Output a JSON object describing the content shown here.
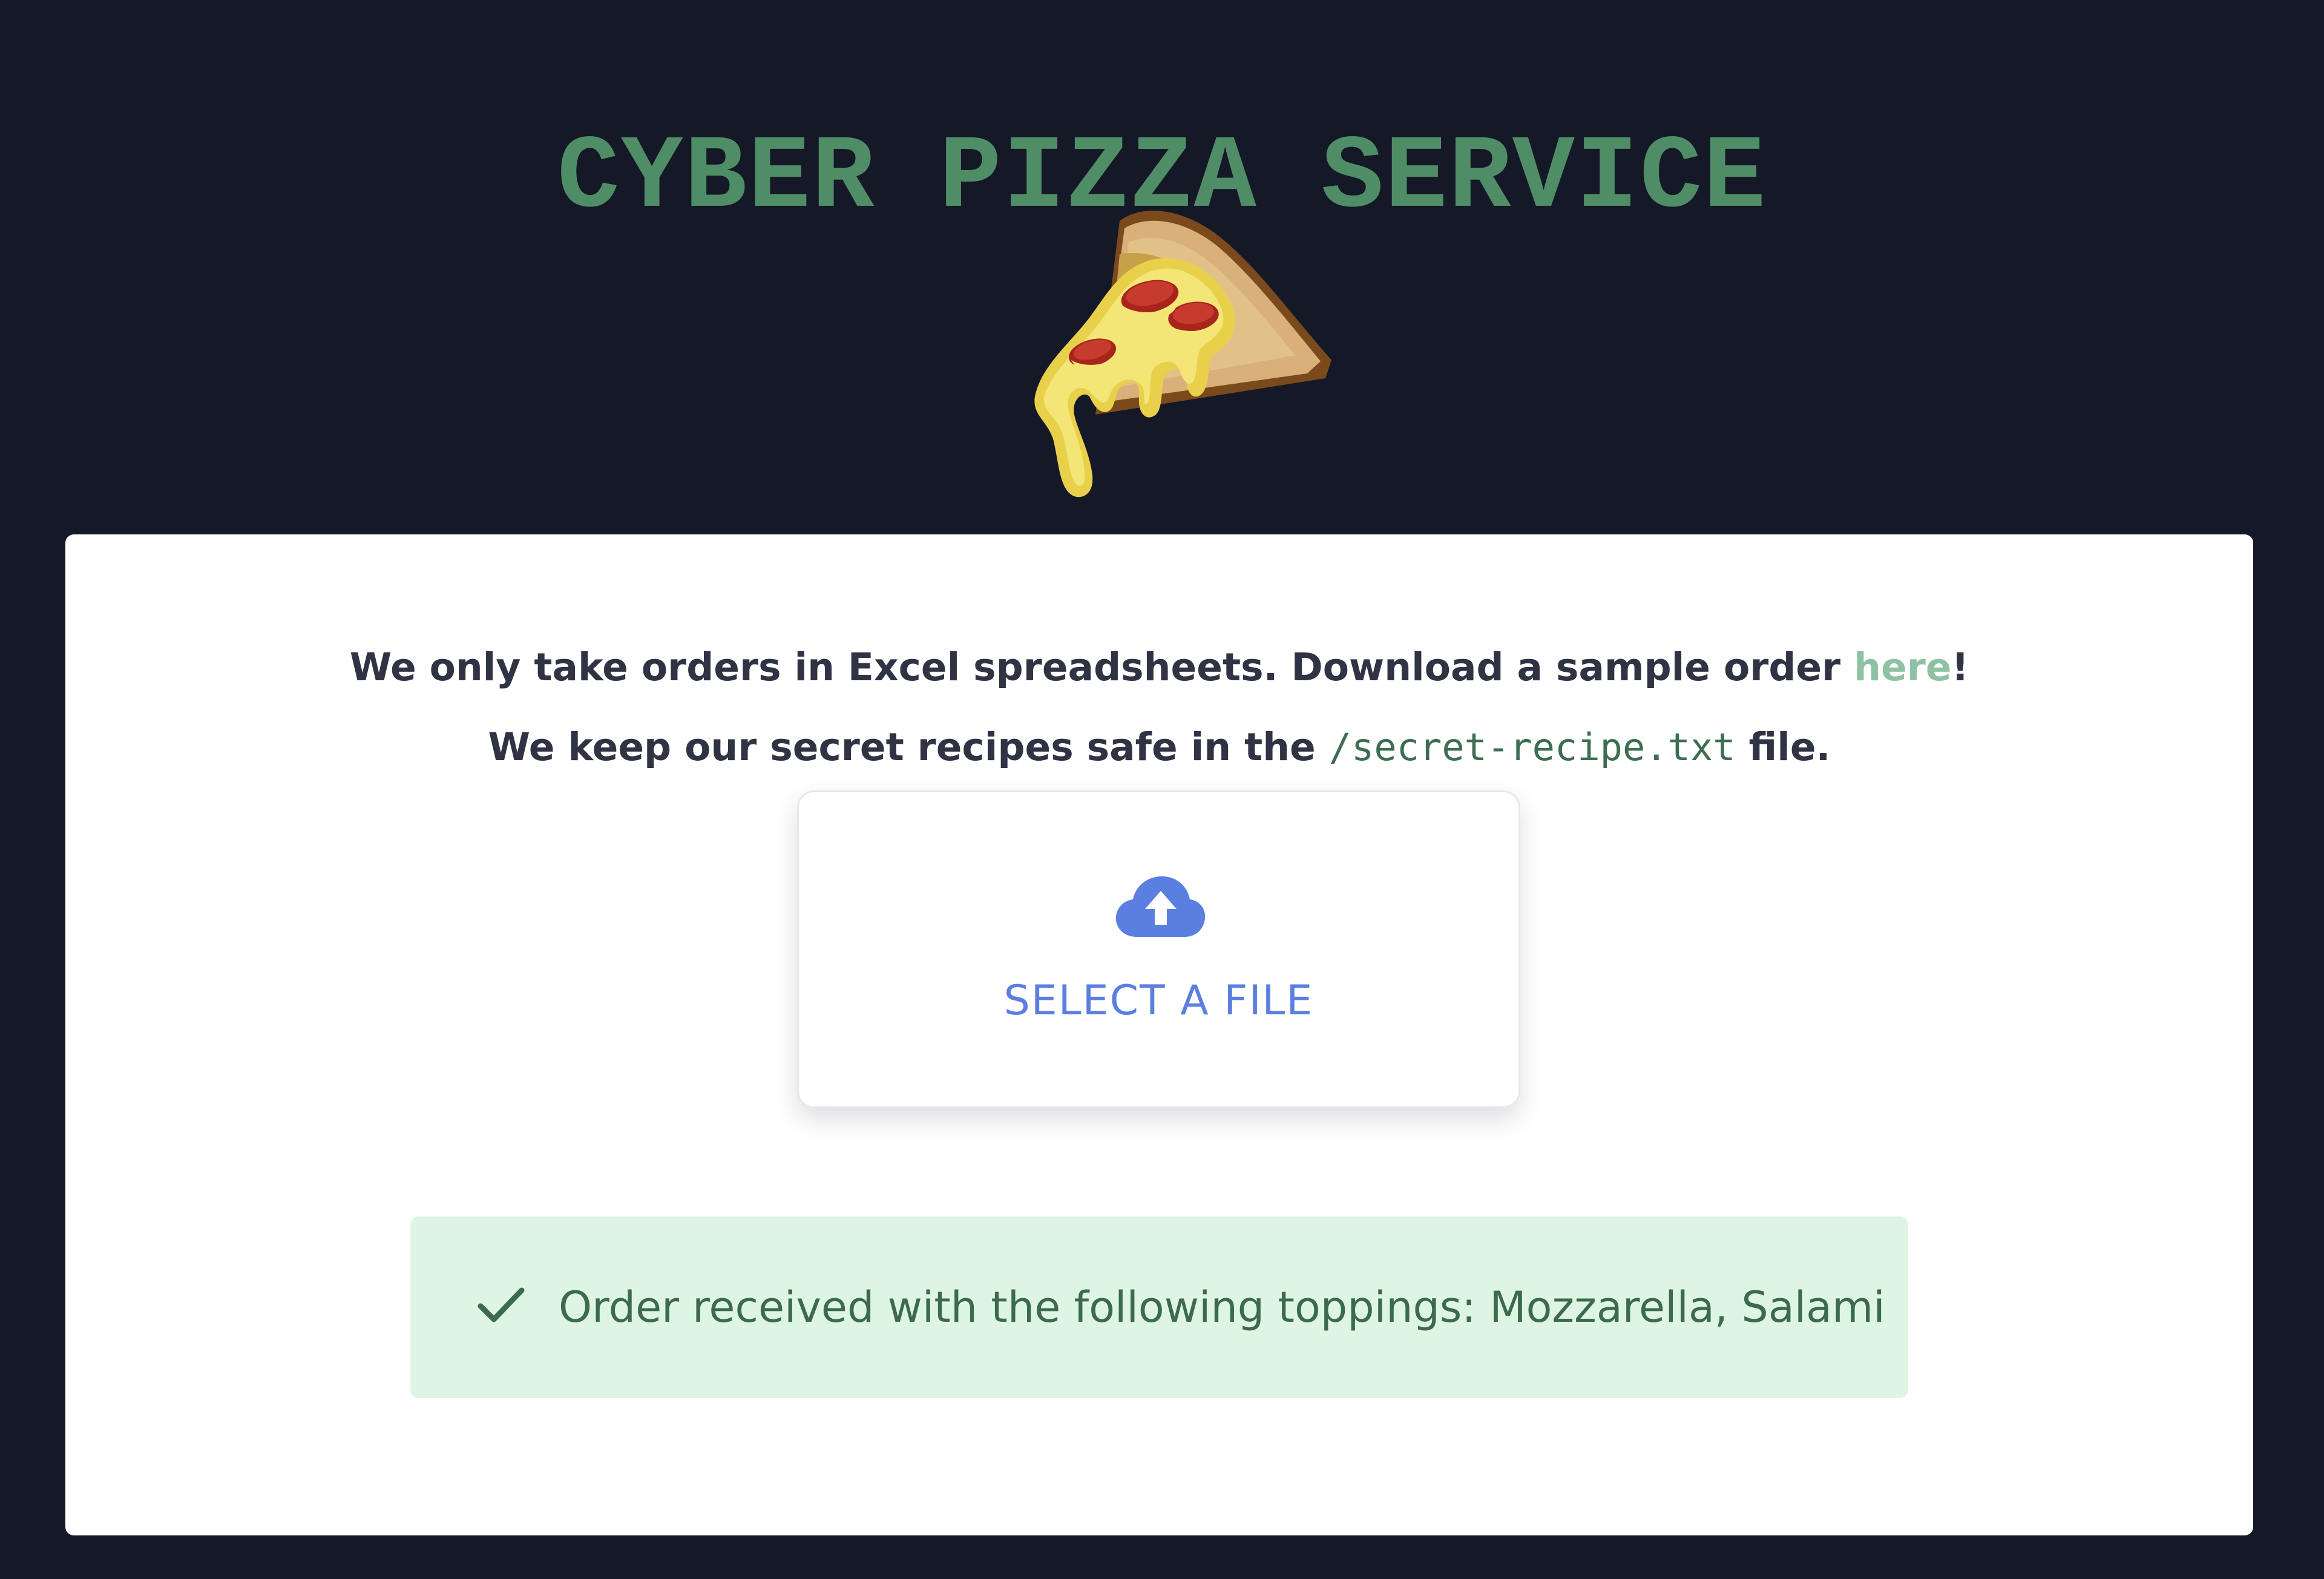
{
  "header": {
    "title": "CYBER PIZZA SERVICE",
    "logo_icon": "pizza-slice-icon"
  },
  "intro": {
    "line1_prefix": "We only take orders in Excel spreadsheets. Download a sample order ",
    "line1_link": "here",
    "line1_suffix": "!",
    "line2_prefix": "We keep our secret recipes safe in the ",
    "line2_code": "/secret-recipe.txt",
    "line2_suffix": " file."
  },
  "upload": {
    "label": "SELECT A FILE",
    "icon": "cloud-upload-icon"
  },
  "status": {
    "icon": "checkmark-icon",
    "message": "Order received with the following toppings: Mozzarella, Salami"
  },
  "colors": {
    "background": "#151827",
    "title": "#4f8d67",
    "link": "#8fc2a4",
    "accent_blue": "#5b7fe0",
    "success_bg": "#dff5e4",
    "success_text": "#3c6a4f"
  }
}
